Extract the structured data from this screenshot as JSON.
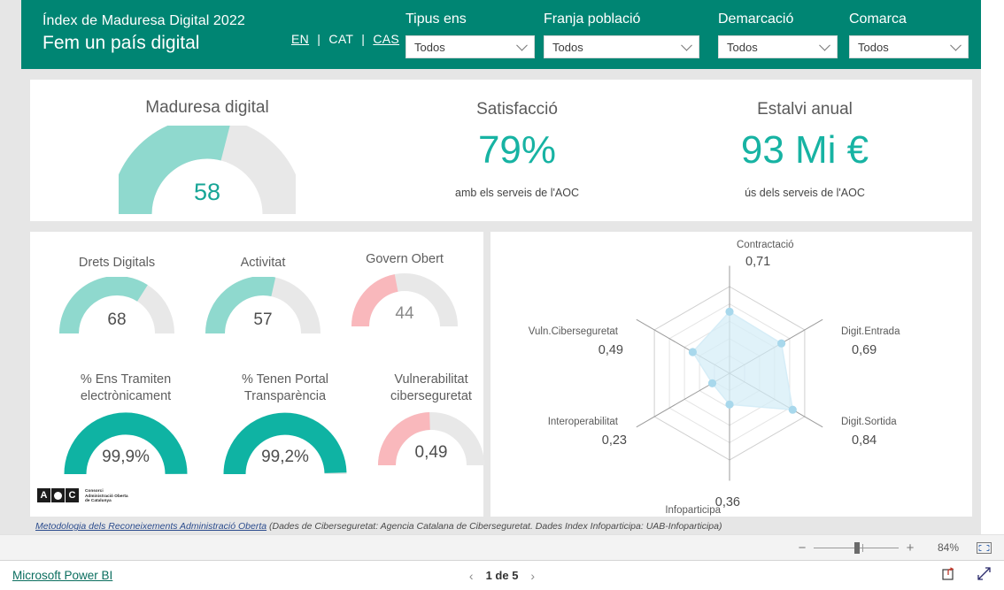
{
  "header": {
    "subtitle": "Índex de Maduresa Digital 2022",
    "title": "Fem un país digital",
    "languages": [
      {
        "label": "EN",
        "current": false
      },
      {
        "label": "CAT",
        "current": true
      },
      {
        "label": "CAS",
        "current": false
      }
    ],
    "separator": "|",
    "brand_color": "#008573"
  },
  "slicers": [
    {
      "label": "Tipus ens",
      "value": "Todos"
    },
    {
      "label": "Franja població",
      "value": "Todos"
    },
    {
      "label": "Demarcació",
      "value": "Todos"
    },
    {
      "label": "Comarca",
      "value": "Todos"
    }
  ],
  "kpis": [
    {
      "title": "Maduresa digital",
      "type": "gauge",
      "value": "58",
      "value_number": 58,
      "max": 100,
      "color": "#8FD9CE"
    },
    {
      "title": "Satisfacció",
      "type": "number",
      "value": "79%",
      "subtitle": "amb els serveis de l'AOC",
      "color": "#17b3a3"
    },
    {
      "title": "Estalvi anual",
      "type": "number",
      "value": "93 Mi €",
      "subtitle": "ús dels serveis de l'AOC",
      "color": "#17b3a3"
    }
  ],
  "gauges": [
    {
      "title": "Drets Digitals",
      "value": "68",
      "pct": 68,
      "color": "#8FD9CE",
      "value_style": "dark"
    },
    {
      "title": "Activitat",
      "value": "57",
      "pct": 57,
      "color": "#8FD9CE",
      "value_style": "dark"
    },
    {
      "title": "Govern Obert",
      "value": "44",
      "pct": 44,
      "color": "#F9B8BC",
      "value_style": "muted"
    },
    {
      "title": "% Ens Tramiten\nelectrònicament",
      "value": "99,9%",
      "pct": 99.9,
      "color": "#0FB3A3",
      "value_style": "dark"
    },
    {
      "title": "% Tenen Portal\nTransparència",
      "value": "99,2%",
      "pct": 99.2,
      "color": "#0FB3A3",
      "value_style": "dark"
    },
    {
      "title": "Vulnerabilitat\nciberseguretat",
      "value": "0,49",
      "pct": 49,
      "color": "#F9B8BC",
      "value_style": "dark"
    }
  ],
  "chart_data": {
    "type": "radar",
    "title": "",
    "categories": [
      "Contractació",
      "Digit.Entrada",
      "Digit.Sortida",
      "Infoparticipa",
      "Interoperabilitat",
      "Vuln.Ciberseguretat"
    ],
    "values": [
      0.71,
      0.69,
      0.84,
      0.36,
      0.23,
      0.49
    ],
    "labels": [
      "0,71",
      "0,69",
      "0,84",
      "0,36",
      "0,23",
      "0,49"
    ],
    "rlim": [
      0,
      1
    ],
    "rings": 5,
    "grid": true,
    "legend": "none",
    "fill_color": "#D6EDF7",
    "marker_color": "#A8D8EC"
  },
  "logo": {
    "a": "A",
    "c": "C",
    "line1": "Consorci",
    "line2": "Administració Oberta",
    "line3": "de Catalunya"
  },
  "footnote": {
    "link": "Metodologia dels Reconeixements Administració Oberta",
    "rest": " (Dades de Ciberseguretat: Agencia Catalana de Ciberseguretat. Dades Index Infoparticipa: UAB-Infoparticipa)"
  },
  "zoombar": {
    "minus": "−",
    "plus": "+",
    "percent": "84%"
  },
  "statusbar": {
    "brand": "Microsoft Power BI",
    "prev": "‹",
    "next": "›",
    "page": "1 de 5"
  }
}
